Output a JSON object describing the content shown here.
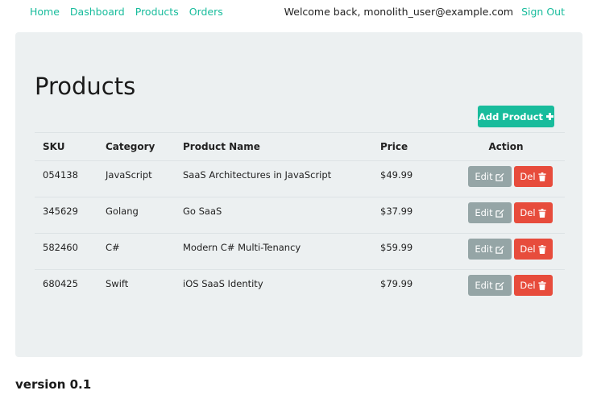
{
  "nav": {
    "links": [
      "Home",
      "Dashboard",
      "Products",
      "Orders"
    ],
    "welcome": "Welcome back, monolith_user@example.com",
    "signout": "Sign Out"
  },
  "page": {
    "title": "Products",
    "add_label": "Add Product"
  },
  "table": {
    "headers": [
      "SKU",
      "Category",
      "Product Name",
      "Price",
      "Action"
    ],
    "rows": [
      {
        "sku": "054138",
        "category": "JavaScript",
        "name": "SaaS Architectures in JavaScript",
        "price": "$49.99"
      },
      {
        "sku": "345629",
        "category": "Golang",
        "name": "Go SaaS",
        "price": "$37.99"
      },
      {
        "sku": "582460",
        "category": "C#",
        "name": "Modern C# Multi-Tenancy",
        "price": "$59.99"
      },
      {
        "sku": "680425",
        "category": "Swift",
        "name": "iOS SaaS Identity",
        "price": "$79.99"
      }
    ],
    "edit_label": "Edit",
    "del_label": "Del"
  },
  "footer": {
    "version": "version 0.1"
  },
  "colors": {
    "accent": "#18bc9c",
    "panel": "#ecf0f1",
    "edit": "#95a5a6",
    "delete": "#e74c3c"
  },
  "icons": {
    "add": "plus-icon",
    "edit": "edit-icon",
    "delete": "trash-icon"
  }
}
